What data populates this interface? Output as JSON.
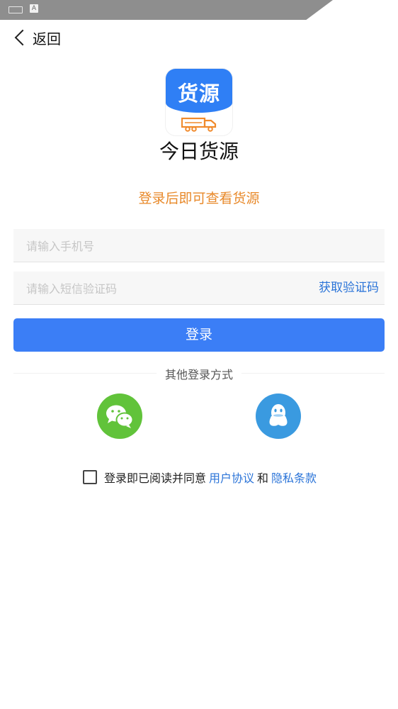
{
  "status_bar": {
    "input_icon": "A"
  },
  "header": {
    "back_label": "返回"
  },
  "logo": {
    "text": "货源"
  },
  "app_name": "今日货源",
  "hint": "登录后即可查看货源",
  "form": {
    "phone_placeholder": "请输入手机号",
    "code_placeholder": "请输入短信验证码",
    "get_code_label": "获取验证码",
    "login_label": "登录"
  },
  "other_login": {
    "label": "其他登录方式",
    "providers": [
      "wechat-icon",
      "qq-icon"
    ]
  },
  "agreement": {
    "prefix": "登录即已阅读并同意",
    "user_agreement": "用户协议",
    "and": "和",
    "privacy": "隐私条款"
  },
  "colors": {
    "primary": "#3b7ef6",
    "accent_orange": "#e8892a",
    "link_blue": "#2b74d8",
    "wechat_green": "#61c33a",
    "qq_blue": "#3a9ae0"
  }
}
